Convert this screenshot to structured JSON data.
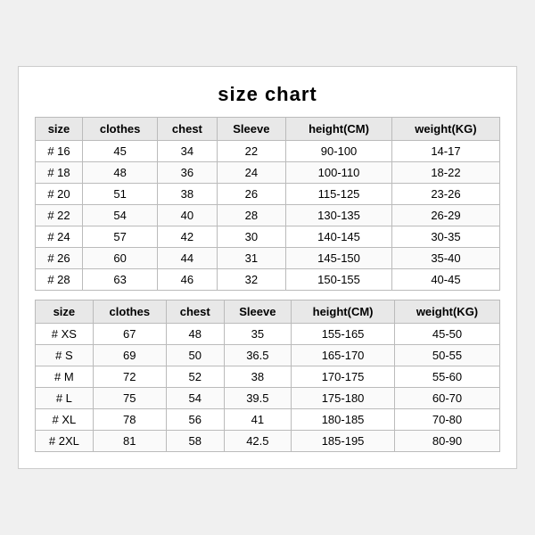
{
  "title": "size chart",
  "table1": {
    "headers": [
      "size",
      "clothes",
      "chest",
      "Sleeve",
      "height(CM)",
      "weight(KG)"
    ],
    "rows": [
      [
        "# 16",
        "45",
        "34",
        "22",
        "90-100",
        "14-17"
      ],
      [
        "# 18",
        "48",
        "36",
        "24",
        "100-110",
        "18-22"
      ],
      [
        "# 20",
        "51",
        "38",
        "26",
        "115-125",
        "23-26"
      ],
      [
        "# 22",
        "54",
        "40",
        "28",
        "130-135",
        "26-29"
      ],
      [
        "# 24",
        "57",
        "42",
        "30",
        "140-145",
        "30-35"
      ],
      [
        "# 26",
        "60",
        "44",
        "31",
        "145-150",
        "35-40"
      ],
      [
        "# 28",
        "63",
        "46",
        "32",
        "150-155",
        "40-45"
      ]
    ]
  },
  "table2": {
    "headers": [
      "size",
      "clothes",
      "chest",
      "Sleeve",
      "height(CM)",
      "weight(KG)"
    ],
    "rows": [
      [
        "# XS",
        "67",
        "48",
        "35",
        "155-165",
        "45-50"
      ],
      [
        "# S",
        "69",
        "50",
        "36.5",
        "165-170",
        "50-55"
      ],
      [
        "# M",
        "72",
        "52",
        "38",
        "170-175",
        "55-60"
      ],
      [
        "# L",
        "75",
        "54",
        "39.5",
        "175-180",
        "60-70"
      ],
      [
        "# XL",
        "78",
        "56",
        "41",
        "180-185",
        "70-80"
      ],
      [
        "# 2XL",
        "81",
        "58",
        "42.5",
        "185-195",
        "80-90"
      ]
    ]
  }
}
